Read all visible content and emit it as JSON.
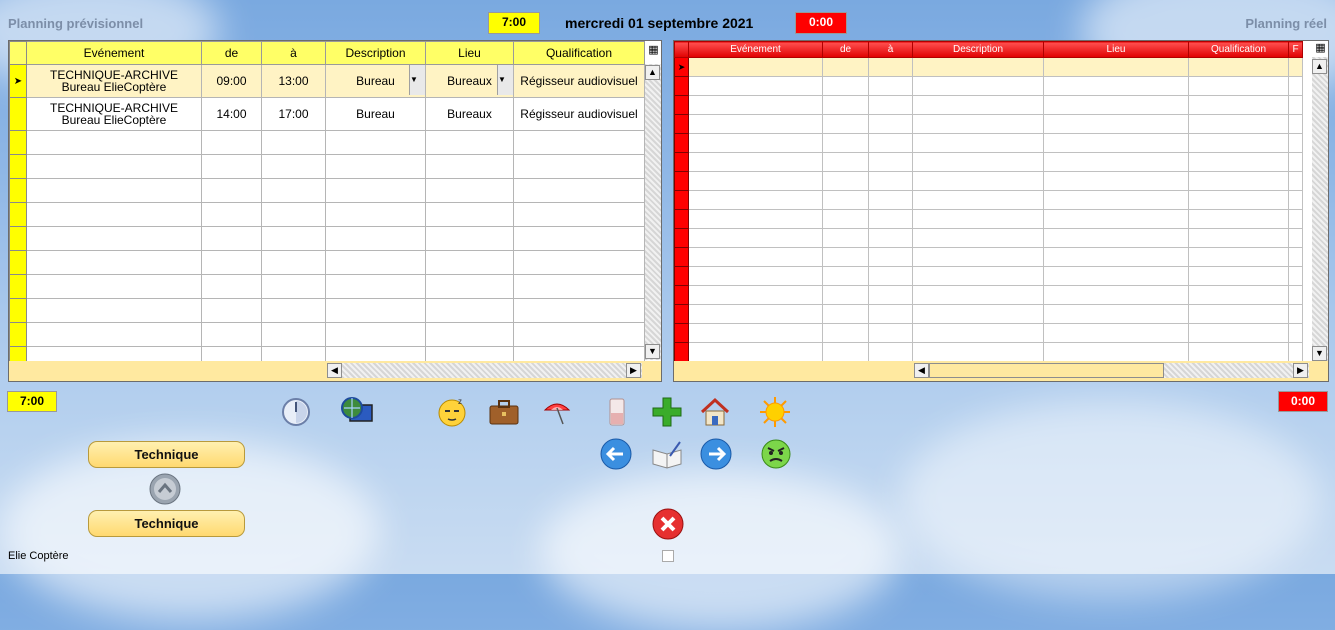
{
  "header": {
    "left_title": "Planning prévisionnel",
    "right_title": "Planning réel",
    "date": "mercredi 01 septembre 2021",
    "time_yellow": "7:00",
    "time_red": "0:00"
  },
  "left_grid": {
    "columns": [
      "Evénement",
      "de",
      "à",
      "Description",
      "Lieu",
      "Qualification"
    ],
    "rows": [
      {
        "event_line1": "TECHNIQUE-ARCHIVE",
        "event_line2": "Bureau ElieCoptère",
        "de": "09:00",
        "a": "13:00",
        "description": "Bureau",
        "lieu": "Bureaux",
        "qualification": "Régisseur audiovisuel"
      },
      {
        "event_line1": "TECHNIQUE-ARCHIVE",
        "event_line2": "Bureau ElieCoptère",
        "de": "14:00",
        "a": "17:00",
        "description": "Bureau",
        "lieu": "Bureaux",
        "qualification": "Régisseur audiovisuel"
      }
    ],
    "empty_rows": 10
  },
  "right_grid": {
    "columns": [
      "Evénement",
      "de",
      "à",
      "Description",
      "Lieu",
      "Qualification",
      "F"
    ],
    "empty_rows": 16
  },
  "totals": {
    "left_time": "7:00",
    "right_time": "0:00"
  },
  "buttons": {
    "technique_top": "Technique",
    "technique_bottom": "Technique"
  },
  "footer": {
    "user_name": "Elie Coptère"
  },
  "colors": {
    "header_yellow": "#ffff66",
    "selector_yellow": "#ffff00",
    "header_red": "#ff0000",
    "selected_row": "#fff3c4"
  }
}
